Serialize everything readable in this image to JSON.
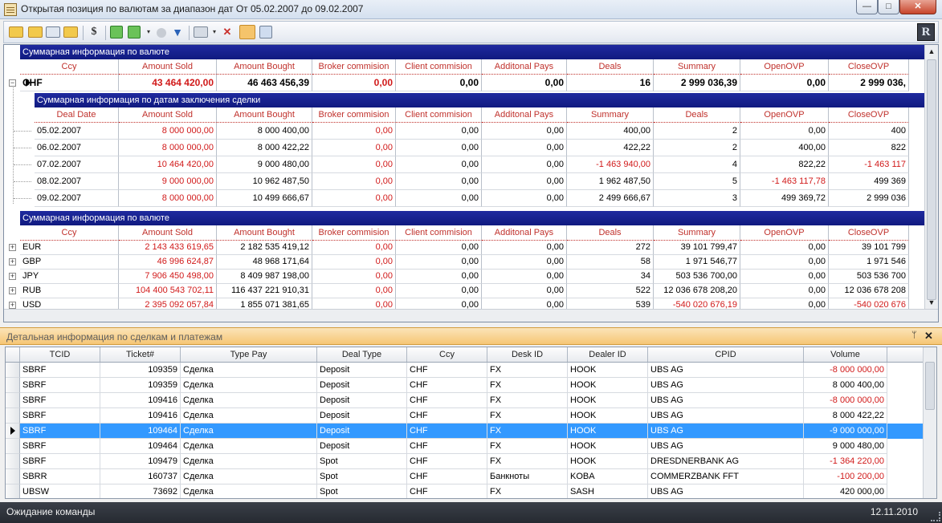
{
  "window": {
    "title": "Открытая позиция по валютам за диапазон дат От 05.02.2007 до 09.02.2007",
    "min_glyph": "—",
    "max_glyph": "□",
    "close_glyph": "✕"
  },
  "toolbar": {
    "icons": [
      "open-folder-icon",
      "folder-icon",
      "network-icon",
      "folder-icon",
      "dollar-icon",
      "refresh-icon",
      "refresh-dropdown-icon",
      "stop-icon",
      "filter-icon",
      "print-icon",
      "delete-icon",
      "active-tool-icon",
      "export-icon"
    ],
    "dollar_glyph": "$",
    "filter_glyph": "▼",
    "delete_glyph": "✕",
    "logo_text": "R"
  },
  "top_grid": {
    "band1": "Суммарная информация по валюте",
    "columns": [
      "Ccy",
      "Amount Sold",
      "Amount Bought",
      "Broker commision",
      "Client commision",
      "Additonal Pays",
      "Deals",
      "Summary",
      "OpenOVP",
      "CloseOVP"
    ],
    "main_row": [
      "CHF",
      "43 464 420,00",
      "46 463 456,39",
      "0,00",
      "0,00",
      "0,00",
      "16",
      "2 999 036,39",
      "0,00",
      "2 999 036,"
    ],
    "band2": "Суммарная информация по датам заключения сделки",
    "date_columns": [
      "Deal Date",
      "Amount Sold",
      "Amount Bought",
      "Broker commision",
      "Client commision",
      "Additonal Pays",
      "Summary",
      "Deals",
      "OpenOVP",
      "CloseOVP"
    ],
    "date_rows": [
      [
        "05.02.2007",
        "8 000 000,00",
        "8 000 400,00",
        "0,00",
        "0,00",
        "0,00",
        "400,00",
        "2",
        "0,00",
        "400"
      ],
      [
        "06.02.2007",
        "8 000 000,00",
        "8 000 422,22",
        "0,00",
        "0,00",
        "0,00",
        "422,22",
        "2",
        "400,00",
        "822"
      ],
      [
        "07.02.2007",
        "10 464 420,00",
        "9 000 480,00",
        "0,00",
        "0,00",
        "0,00",
        "-1 463 940,00",
        "4",
        "822,22",
        "-1 463 117"
      ],
      [
        "08.02.2007",
        "9 000 000,00",
        "10 962 487,50",
        "0,00",
        "0,00",
        "0,00",
        "1 962 487,50",
        "5",
        "-1 463 117,78",
        "499 369"
      ],
      [
        "09.02.2007",
        "8 000 000,00",
        "10 499 666,67",
        "0,00",
        "0,00",
        "0,00",
        "2 499 666,67",
        "3",
        "499 369,72",
        "2 999 036"
      ]
    ],
    "band3": "Суммарная информация по валюте",
    "ccy_rows": [
      [
        "EUR",
        "2 143 433 619,65",
        "2 182 535 419,12",
        "0,00",
        "0,00",
        "0,00",
        "272",
        "39 101 799,47",
        "0,00",
        "39 101 799"
      ],
      [
        "GBP",
        "46 996 624,87",
        "48 968 171,64",
        "0,00",
        "0,00",
        "0,00",
        "58",
        "1 971 546,77",
        "0,00",
        "1 971 546"
      ],
      [
        "JPY",
        "7 906 450 498,00",
        "8 409 987 198,00",
        "0,00",
        "0,00",
        "0,00",
        "34",
        "503 536 700,00",
        "0,00",
        "503 536 700"
      ],
      [
        "RUB",
        "104 400 543 702,11",
        "116 437 221 910,31",
        "0,00",
        "0,00",
        "0,00",
        "522",
        "12 036 678 208,20",
        "0,00",
        "12 036 678 208"
      ],
      [
        "USD",
        "2 395 092 057,84",
        "1 855 071 381,65",
        "0,00",
        "0,00",
        "0,00",
        "539",
        "-540 020 676,19",
        "0,00",
        "-540 020 676"
      ]
    ]
  },
  "detail": {
    "title": "Детальная информация по сделкам и платежам",
    "pin_glyph": "ᛘ",
    "close_glyph": "✕",
    "columns": [
      "TCID",
      "Ticket#",
      "Type Pay",
      "Deal Type",
      "Ccy",
      "Desk ID",
      "Dealer ID",
      "CPID",
      "Volume"
    ],
    "rows": [
      [
        "SBRF",
        "109359",
        "Сделка",
        "Deposit",
        "CHF",
        "FX",
        "HOOK",
        "UBS AG",
        "-8 000 000,00"
      ],
      [
        "SBRF",
        "109359",
        "Сделка",
        "Deposit",
        "CHF",
        "FX",
        "HOOK",
        "UBS AG",
        "8 000 400,00"
      ],
      [
        "SBRF",
        "109416",
        "Сделка",
        "Deposit",
        "CHF",
        "FX",
        "HOOK",
        "UBS AG",
        "-8 000 000,00"
      ],
      [
        "SBRF",
        "109416",
        "Сделка",
        "Deposit",
        "CHF",
        "FX",
        "HOOK",
        "UBS AG",
        "8 000 422,22"
      ],
      [
        "SBRF",
        "109464",
        "Сделка",
        "Deposit",
        "CHF",
        "FX",
        "HOOK",
        "UBS AG",
        "-9 000 000,00"
      ],
      [
        "SBRF",
        "109464",
        "Сделка",
        "Deposit",
        "CHF",
        "FX",
        "HOOK",
        "UBS AG",
        "9 000 480,00"
      ],
      [
        "SBRF",
        "109479",
        "Сделка",
        "Spot",
        "CHF",
        "FX",
        "HOOK",
        "DRESDNERBANK AG",
        "-1 364 220,00"
      ],
      [
        "SBRR",
        "160737",
        "Сделка",
        "Spot",
        "CHF",
        "Банкноты",
        "KOBA",
        "COMMERZBANK FFT",
        "-100 200,00"
      ],
      [
        "UBSW",
        "73692",
        "Сделка",
        "Spot",
        "CHF",
        "FX",
        "SASH",
        "UBS AG",
        "420 000,00"
      ]
    ],
    "selected_index": 4
  },
  "status": {
    "message": "Ожидание команды",
    "date": "12.11.2010"
  },
  "colors": {
    "band": "#101a80",
    "negative": "#d11a1a",
    "selection": "#3399ff",
    "pane_header": "#f6c675"
  }
}
